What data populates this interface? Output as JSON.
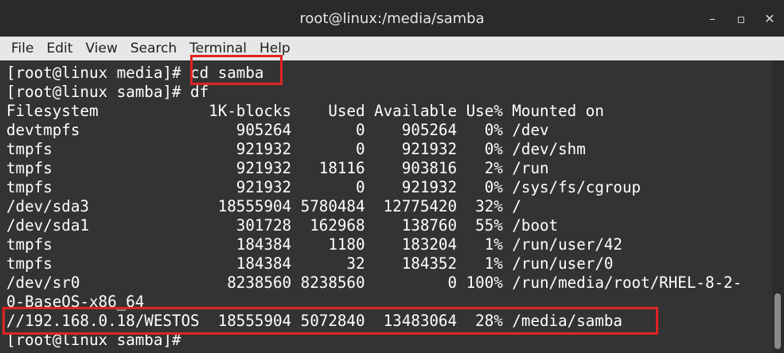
{
  "window": {
    "title": "root@linux:/media/samba",
    "controls": {
      "minimize": "–",
      "maximize": "▫",
      "close": "✕"
    }
  },
  "menu": [
    "File",
    "Edit",
    "View",
    "Search",
    "Terminal",
    "Help"
  ],
  "terminal": {
    "lines": [
      "[root@linux media]# cd samba",
      "[root@linux samba]# df",
      "Filesystem            1K-blocks    Used Available Use% Mounted on",
      "devtmpfs                 905264       0    905264   0% /dev",
      "tmpfs                    921932       0    921932   0% /dev/shm",
      "tmpfs                    921932   18116    903816   2% /run",
      "tmpfs                    921932       0    921932   0% /sys/fs/cgroup",
      "/dev/sda3              18555904 5780484  12775420  32% /",
      "/dev/sda1                301728  162968    138760  55% /boot",
      "tmpfs                    184384    1180    183204   1% /run/user/42",
      "tmpfs                    184384      32    184352   1% /run/user/0",
      "/dev/sr0                8238560 8238560         0 100% /run/media/root/RHEL-8-2-",
      "0-BaseOS-x86_64",
      "//192.168.0.18/WESTOS  18555904 5072840  13483064  28% /media/samba",
      "[root@linux samba]#"
    ]
  },
  "highlight_color": "#e02424"
}
